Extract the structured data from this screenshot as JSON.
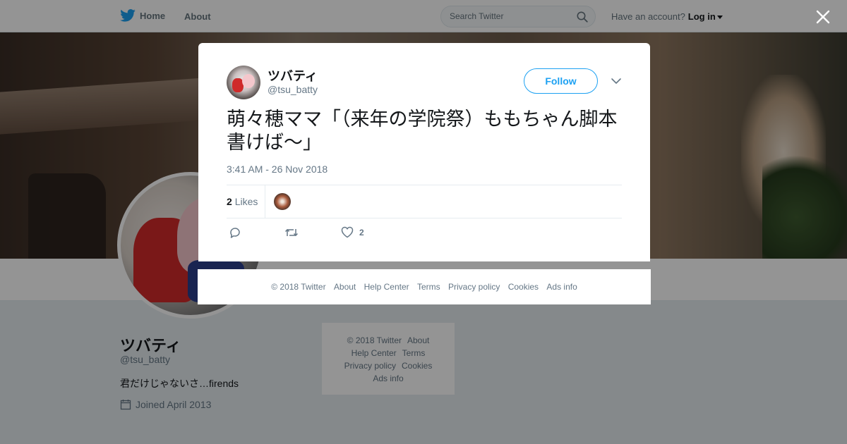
{
  "topbar": {
    "home_label": "Home",
    "about_label": "About",
    "search_placeholder": "Search Twitter",
    "have_account": "Have an account?",
    "login_label": "Log in",
    "brand_color": "#1da1f2"
  },
  "profile": {
    "name": "ツバティ",
    "handle": "@tsu_batty",
    "bio": "君だけじゃないさ…firends",
    "joined": "Joined April 2013"
  },
  "bg_footer": {
    "copyright": "© 2018 Twitter",
    "about": "About",
    "help": "Help Center",
    "terms": "Terms",
    "privacy": "Privacy policy",
    "cookies": "Cookies",
    "ads": "Ads info"
  },
  "tweet": {
    "name": "ツバティ",
    "handle": "@tsu_batty",
    "follow_label": "Follow",
    "text": "萌々穂ママ「（来年の学院祭）ももちゃん脚本書けば〜」",
    "timestamp": "3:41 AM - 26 Nov 2018",
    "likes_count": "2",
    "likes_label": "Likes",
    "like_action_count": "2"
  },
  "modal_footer": {
    "copyright": "© 2018 Twitter",
    "about": "About",
    "help": "Help Center",
    "terms": "Terms",
    "privacy": "Privacy policy",
    "cookies": "Cookies",
    "ads": "Ads info"
  },
  "icons": {
    "logo": "twitter-bird-icon",
    "search": "search-icon",
    "close": "close-icon",
    "more": "chevron-down-icon",
    "reply": "reply-icon",
    "retweet": "retweet-icon",
    "like": "heart-icon",
    "calendar": "calendar-icon"
  }
}
